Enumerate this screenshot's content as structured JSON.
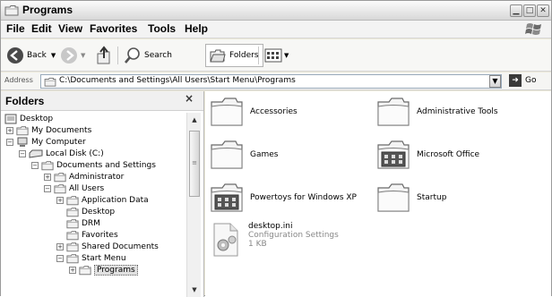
{
  "window": {
    "title": "Programs"
  },
  "menu": [
    "File",
    "Edit",
    "View",
    "Favorites",
    "Tools",
    "Help"
  ],
  "toolbar": {
    "back": "Back",
    "search": "Search",
    "folders": "Folders"
  },
  "address": {
    "label": "Address",
    "path": "C:\\Documents and Settings\\All Users\\Start Menu\\Programs",
    "go": "Go"
  },
  "pane": {
    "title": "Folders",
    "close": "×"
  },
  "tree": [
    {
      "label": "Desktop"
    },
    {
      "label": "My Documents"
    },
    {
      "label": "My Computer"
    },
    {
      "label": "Local Disk (C:)"
    },
    {
      "label": "Documents and Settings"
    },
    {
      "label": "Administrator"
    },
    {
      "label": "All Users"
    },
    {
      "label": "Application Data"
    },
    {
      "label": "Desktop"
    },
    {
      "label": "DRM"
    },
    {
      "label": "Favorites"
    },
    {
      "label": "Shared Documents"
    },
    {
      "label": "Start Menu"
    },
    {
      "label": "Programs"
    }
  ],
  "items": [
    {
      "name": "Accessories"
    },
    {
      "name": "Administrative Tools"
    },
    {
      "name": "Games"
    },
    {
      "name": "Microsoft Office"
    },
    {
      "name": "Powertoys for Windows XP"
    },
    {
      "name": "Startup"
    }
  ],
  "file": {
    "name": "desktop.ini",
    "type": "Configuration Settings",
    "size": "1 KB"
  }
}
